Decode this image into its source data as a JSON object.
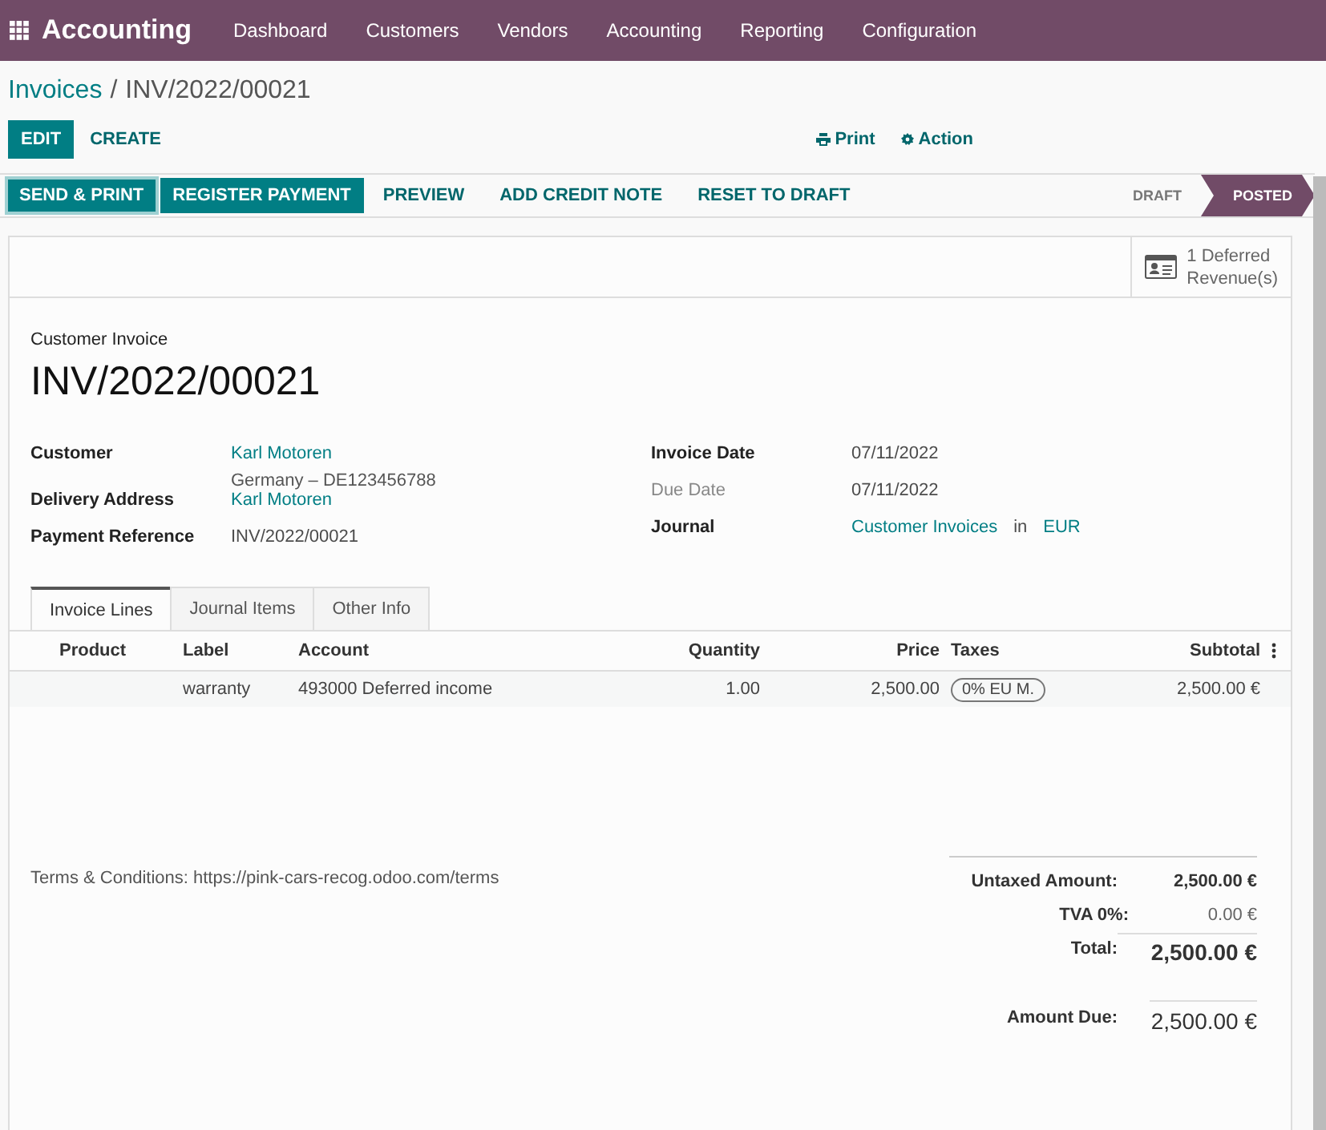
{
  "navbar": {
    "app_name": "Accounting",
    "menu": [
      "Dashboard",
      "Customers",
      "Vendors",
      "Accounting",
      "Reporting",
      "Configuration"
    ]
  },
  "breadcrumb": {
    "parent": "Invoices",
    "separator": "/",
    "current": "INV/2022/00021"
  },
  "control_buttons": [
    {
      "label": "EDIT",
      "kind": "primary"
    },
    {
      "label": "CREATE",
      "kind": "link"
    }
  ],
  "actions": [
    {
      "label": "Print",
      "kind": "print"
    },
    {
      "label": "Action",
      "kind": "gear"
    }
  ],
  "header_buttons": [
    {
      "label": "SEND & PRINT",
      "kind": "primary"
    },
    {
      "label": "REGISTER PAYMENT",
      "kind": "primary"
    },
    {
      "label": "PREVIEW",
      "kind": "link"
    },
    {
      "label": "ADD CREDIT NOTE",
      "kind": "link"
    },
    {
      "label": "RESET TO DRAFT",
      "kind": "link"
    }
  ],
  "status": [
    {
      "label": "DRAFT",
      "selected": false
    },
    {
      "label": "POSTED",
      "selected": true
    }
  ],
  "smart_button": {
    "lines": [
      "1 Deferred",
      "Revenue(s)"
    ]
  },
  "document": {
    "type_label": "Customer Invoice",
    "number": "INV/2022/00021"
  },
  "left_fields": [
    {
      "label": "Customer",
      "values": [
        {
          "text": "Karl Motoren",
          "link": true
        }
      ],
      "address": "Germany – DE123456788"
    },
    {
      "label": "Delivery Address",
      "values": [
        {
          "text": "Karl Motoren",
          "link": true
        }
      ]
    },
    {
      "label": "Payment Reference",
      "values": [
        {
          "text": "INV/2022/00021",
          "link": false
        }
      ]
    }
  ],
  "right_fields": [
    {
      "label": "Invoice Date",
      "muted": false,
      "values": [
        {
          "text": "07/11/2022",
          "link": false
        }
      ]
    },
    {
      "label": "Due Date",
      "muted": true,
      "values": [
        {
          "text": "07/11/2022",
          "link": false
        }
      ]
    },
    {
      "label": "Journal",
      "muted": false,
      "values": [
        {
          "text": "Customer Invoices",
          "link": true
        },
        {
          "text": "in",
          "link": false
        },
        {
          "text": "EUR",
          "link": true
        }
      ]
    }
  ],
  "tabs": [
    {
      "label": "Invoice Lines",
      "selected": true
    },
    {
      "label": "Journal Items",
      "selected": false
    },
    {
      "label": "Other Info",
      "selected": false
    }
  ],
  "table": {
    "columns": [
      "Product",
      "Label",
      "Account",
      "Quantity",
      "Price",
      "Taxes",
      "Subtotal"
    ],
    "rows": [
      {
        "label": "warranty",
        "account": "493000 Deferred income",
        "quantity": "1.00",
        "price": "2,500.00",
        "taxes": "0% EU M.",
        "subtotal": "2,500.00 €"
      }
    ]
  },
  "terms": "Terms & Conditions: https://pink-cars-recog.odoo.com/terms",
  "totals": [
    {
      "label": "Untaxed Amount:",
      "value": "2,500.00 €",
      "kind": "subtotal"
    },
    {
      "label": "TVA 0%:",
      "value": "0.00 €",
      "kind": "tax"
    },
    {
      "label": "Total:",
      "value": "2,500.00 €",
      "kind": "total"
    },
    {
      "label": "Amount Due:",
      "value": "2,500.00 €",
      "kind": "due"
    }
  ]
}
